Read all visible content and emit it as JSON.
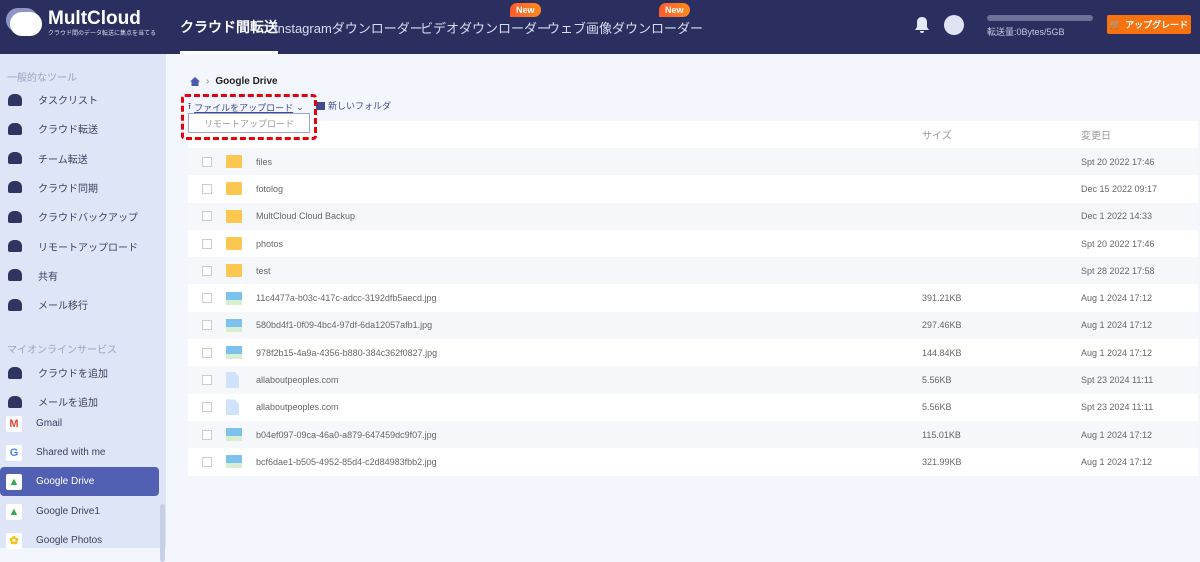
{
  "header": {
    "logo_title": "MultCloud",
    "logo_subtitle": "クラウド間のデータ転送に集点を当てる",
    "nav": [
      {
        "label": "クラウド間転送"
      },
      {
        "label": "Instagramダウンローダー"
      },
      {
        "label": "ビデオダウンローダー",
        "badge": "New"
      },
      {
        "label": "ウェブ画像ダウンローダー",
        "badge": "New"
      }
    ],
    "usage_text": "転送量:0Bytes/5GB",
    "usage_fraction": 0,
    "upgrade_label": "アップグレード"
  },
  "sidebar": {
    "section1": "一般的なツール",
    "tools": [
      "タスクリスト",
      "クラウド転送",
      "チーム転送",
      "クラウド同期",
      "クラウドバックアップ",
      "リモートアップロード",
      "共有",
      "メール移行"
    ],
    "section2": "マイオンラインサービス",
    "services": [
      "クラウドを追加",
      "メールを追加",
      "Gmail",
      "Shared with me",
      "Google Drive",
      "Google Drive1",
      "Google Photos"
    ]
  },
  "main": {
    "breadcrumb": "Google Drive",
    "upload_label": "ファイルをアップロード",
    "new_folder_label": "新しいフォルダ",
    "dropdown_item": "リモートアップロード",
    "columns": {
      "size": "サイズ",
      "date": "変更日"
    },
    "files": [
      {
        "type": "folder",
        "name": "files",
        "size": "",
        "date": "Spt 20 2022 17:46"
      },
      {
        "type": "folder",
        "name": "fotolog",
        "size": "",
        "date": "Dec 15 2022 09:17"
      },
      {
        "type": "folder",
        "name": "MultCloud Cloud Backup",
        "size": "",
        "date": "Dec 1 2022 14:33"
      },
      {
        "type": "folder",
        "name": "photos",
        "size": "",
        "date": "Spt 20 2022 17:46"
      },
      {
        "type": "folder",
        "name": "test",
        "size": "",
        "date": "Spt 28 2022 17:58"
      },
      {
        "type": "img",
        "name": "11c4477a-b03c-417c-adcc-3192dfb5aecd.jpg",
        "size": "391.21KB",
        "date": "Aug 1 2024 17:12"
      },
      {
        "type": "img",
        "name": "580bd4f1-0f09-4bc4-97df-6da12057afb1.jpg",
        "size": "297.46KB",
        "date": "Aug 1 2024 17:12"
      },
      {
        "type": "img",
        "name": "978f2b15-4a9a-4356-b880-384c362f0827.jpg",
        "size": "144.84KB",
        "date": "Aug 1 2024 17:12"
      },
      {
        "type": "doc",
        "name": "allaboutpeoples.com",
        "size": "5.56KB",
        "date": "Spt 23 2024 11:11"
      },
      {
        "type": "doc",
        "name": "allaboutpeoples.com",
        "size": "5.56KB",
        "date": "Spt 23 2024 11:11"
      },
      {
        "type": "img",
        "name": "b04ef097-09ca-46a0-a879-647459dc9f07.jpg",
        "size": "115.01KB",
        "date": "Aug 1 2024 17:12"
      },
      {
        "type": "img",
        "name": "bcf6dae1-b505-4952-85d4-c2d84983fbb2.jpg",
        "size": "321.99KB",
        "date": "Aug 1 2024 17:12"
      }
    ]
  }
}
